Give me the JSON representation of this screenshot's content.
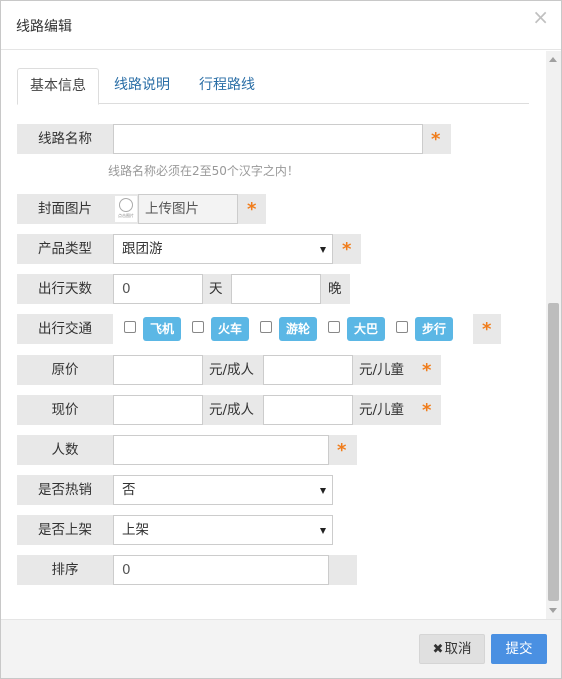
{
  "dialog": {
    "title": "线路编辑",
    "close_icon": "close-icon"
  },
  "tabs": [
    {
      "label": "基本信息",
      "active": true
    },
    {
      "label": "线路说明",
      "active": false
    },
    {
      "label": "行程路线",
      "active": false
    }
  ],
  "form": {
    "route_name": {
      "label": "线路名称",
      "value": "",
      "hint": "线路名称必须在2至50个汉字之内！"
    },
    "cover_image": {
      "label": "封面图片",
      "button": "上传图片",
      "thumbnail_caption": "点击图片"
    },
    "product_type": {
      "label": "产品类型",
      "selected": "跟团游"
    },
    "travel_days": {
      "label": "出行天数",
      "days_value": "0",
      "days_unit": "天",
      "nights_value": "",
      "nights_unit": "晚"
    },
    "transport": {
      "label": "出行交通",
      "options": [
        {
          "label": "飞机",
          "checked": false
        },
        {
          "label": "火车",
          "checked": false
        },
        {
          "label": "游轮",
          "checked": false
        },
        {
          "label": "大巴",
          "checked": false
        },
        {
          "label": "步行",
          "checked": false
        }
      ]
    },
    "original_price": {
      "label": "原价",
      "adult_value": "",
      "adult_unit": "元/成人",
      "child_value": "",
      "child_unit": "元/儿童"
    },
    "current_price": {
      "label": "现价",
      "adult_value": "",
      "adult_unit": "元/成人",
      "child_value": "",
      "child_unit": "元/儿童"
    },
    "people_count": {
      "label": "人数",
      "value": ""
    },
    "hot_sale": {
      "label": "是否热销",
      "selected": "否"
    },
    "on_shelf": {
      "label": "是否上架",
      "selected": "上架"
    },
    "sort": {
      "label": "排序",
      "value": "0"
    },
    "required_mark": "*"
  },
  "footer": {
    "cancel_label": "取消",
    "cancel_icon_glyph": "✖",
    "submit_label": "提交"
  },
  "colors": {
    "tag_bg": "#5bb7e5",
    "required_star": "#f07d1c",
    "submit_bg": "#4a90e2"
  }
}
